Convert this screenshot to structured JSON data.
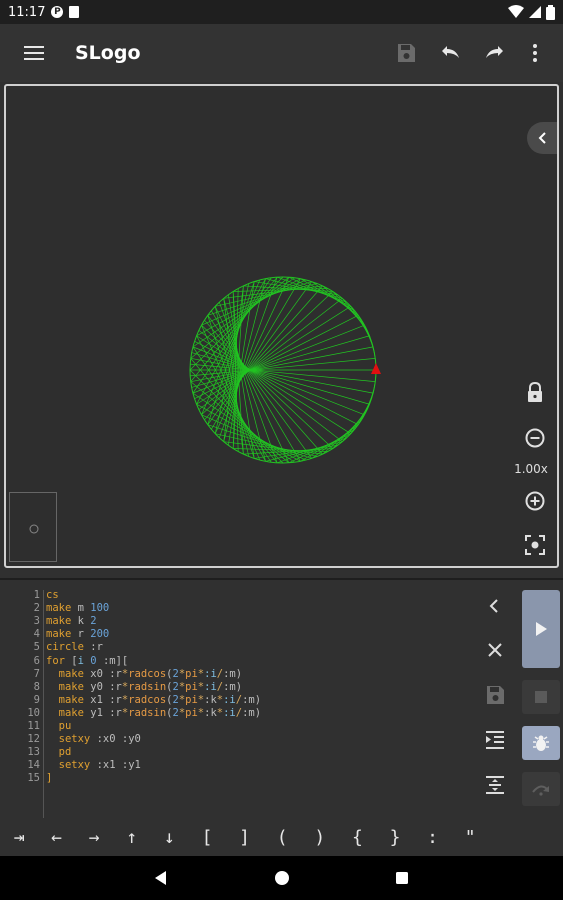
{
  "status_bar": {
    "time": "11:17",
    "badge_letter": "P",
    "battery_icon": "battery-icon",
    "wifi_icon": "wifi-icon",
    "signal_icon": "signal-icon"
  },
  "app_bar": {
    "title": "SLogo",
    "menu_icon": "hamburger-menu-icon",
    "save_icon": "save-icon",
    "undo_icon": "undo-icon",
    "redo_icon": "redo-icon",
    "more_icon": "more-vert-icon"
  },
  "canvas": {
    "zoom_label": "1.00x",
    "drawing": {
      "circle_radius": 200,
      "n": 100,
      "k": 2,
      "line_color": "#22c522",
      "turtle_color": "#e01010"
    }
  },
  "editor": {
    "lines": [
      {
        "num": "1",
        "tokens": [
          {
            "t": "cs",
            "c": "k"
          }
        ]
      },
      {
        "num": "2",
        "tokens": [
          {
            "t": "make ",
            "c": "k"
          },
          {
            "t": "m ",
            "c": "v"
          },
          {
            "t": "100",
            "c": "n"
          }
        ]
      },
      {
        "num": "3",
        "tokens": [
          {
            "t": "make ",
            "c": "k"
          },
          {
            "t": "k ",
            "c": "v"
          },
          {
            "t": "2",
            "c": "n"
          }
        ]
      },
      {
        "num": "4",
        "tokens": [
          {
            "t": "make ",
            "c": "k"
          },
          {
            "t": "r ",
            "c": "v"
          },
          {
            "t": "200",
            "c": "n"
          }
        ]
      },
      {
        "num": "5",
        "tokens": [
          {
            "t": "circle ",
            "c": "k"
          },
          {
            "t": ":r",
            "c": "v"
          }
        ]
      },
      {
        "num": "6",
        "tokens": [
          {
            "t": "for ",
            "c": "k"
          },
          {
            "t": "[",
            "c": "v"
          },
          {
            "t": "i ",
            "c": "r"
          },
          {
            "t": "0 ",
            "c": "n"
          },
          {
            "t": ":m",
            "c": "v"
          },
          {
            "t": "][",
            "c": "v"
          }
        ]
      },
      {
        "num": "7",
        "tokens": [
          {
            "t": "  make ",
            "c": "k"
          },
          {
            "t": "x0 ",
            "c": "v"
          },
          {
            "t": ":r",
            "c": "v"
          },
          {
            "t": "*",
            "c": "o"
          },
          {
            "t": "radcos",
            "c": "f"
          },
          {
            "t": "(",
            "c": "v"
          },
          {
            "t": "2",
            "c": "n"
          },
          {
            "t": "*",
            "c": "o"
          },
          {
            "t": "pi",
            "c": "f"
          },
          {
            "t": "*",
            "c": "o"
          },
          {
            "t": ":i",
            "c": "r"
          },
          {
            "t": "/",
            "c": "o"
          },
          {
            "t": ":m",
            "c": "v"
          },
          {
            "t": ")",
            "c": "v"
          }
        ]
      },
      {
        "num": "8",
        "tokens": [
          {
            "t": "  make ",
            "c": "k"
          },
          {
            "t": "y0 ",
            "c": "v"
          },
          {
            "t": ":r",
            "c": "v"
          },
          {
            "t": "*",
            "c": "o"
          },
          {
            "t": "radsin",
            "c": "f"
          },
          {
            "t": "(",
            "c": "v"
          },
          {
            "t": "2",
            "c": "n"
          },
          {
            "t": "*",
            "c": "o"
          },
          {
            "t": "pi",
            "c": "f"
          },
          {
            "t": "*",
            "c": "o"
          },
          {
            "t": ":i",
            "c": "r"
          },
          {
            "t": "/",
            "c": "o"
          },
          {
            "t": ":m",
            "c": "v"
          },
          {
            "t": ")",
            "c": "v"
          }
        ]
      },
      {
        "num": "9",
        "tokens": [
          {
            "t": "  make ",
            "c": "k"
          },
          {
            "t": "x1 ",
            "c": "v"
          },
          {
            "t": ":r",
            "c": "v"
          },
          {
            "t": "*",
            "c": "o"
          },
          {
            "t": "radcos",
            "c": "f"
          },
          {
            "t": "(",
            "c": "v"
          },
          {
            "t": "2",
            "c": "n"
          },
          {
            "t": "*",
            "c": "o"
          },
          {
            "t": "pi",
            "c": "f"
          },
          {
            "t": "*",
            "c": "o"
          },
          {
            "t": ":k",
            "c": "v"
          },
          {
            "t": "*",
            "c": "o"
          },
          {
            "t": ":i",
            "c": "r"
          },
          {
            "t": "/",
            "c": "o"
          },
          {
            "t": ":m",
            "c": "v"
          },
          {
            "t": ")",
            "c": "v"
          }
        ]
      },
      {
        "num": "10",
        "tokens": [
          {
            "t": "  make ",
            "c": "k"
          },
          {
            "t": "y1 ",
            "c": "v"
          },
          {
            "t": ":r",
            "c": "v"
          },
          {
            "t": "*",
            "c": "o"
          },
          {
            "t": "radsin",
            "c": "f"
          },
          {
            "t": "(",
            "c": "v"
          },
          {
            "t": "2",
            "c": "n"
          },
          {
            "t": "*",
            "c": "o"
          },
          {
            "t": "pi",
            "c": "f"
          },
          {
            "t": "*",
            "c": "o"
          },
          {
            "t": ":k",
            "c": "v"
          },
          {
            "t": "*",
            "c": "o"
          },
          {
            "t": ":i",
            "c": "r"
          },
          {
            "t": "/",
            "c": "o"
          },
          {
            "t": ":m",
            "c": "v"
          },
          {
            "t": ")",
            "c": "v"
          }
        ]
      },
      {
        "num": "11",
        "tokens": [
          {
            "t": "  pu",
            "c": "k"
          }
        ]
      },
      {
        "num": "12",
        "tokens": [
          {
            "t": "  setxy ",
            "c": "k"
          },
          {
            "t": ":x0 ",
            "c": "v"
          },
          {
            "t": ":y0",
            "c": "v"
          }
        ]
      },
      {
        "num": "13",
        "tokens": [
          {
            "t": "  pd",
            "c": "k"
          }
        ]
      },
      {
        "num": "14",
        "tokens": [
          {
            "t": "  setxy ",
            "c": "k"
          },
          {
            "t": ":x1 ",
            "c": "v"
          },
          {
            "t": ":y1",
            "c": "v"
          }
        ]
      },
      {
        "num": "15",
        "tokens": [
          {
            "t": "]",
            "c": "k"
          }
        ]
      }
    ]
  },
  "symbols": [
    "⇥",
    "←",
    "→",
    "↑",
    "↓",
    "[",
    "]",
    "(",
    ")",
    "{",
    "}",
    ":",
    "\""
  ],
  "colors": {
    "accent_run": "#8a96ac",
    "accent_debug": "#9aa7c0",
    "line_green": "#22c522"
  }
}
